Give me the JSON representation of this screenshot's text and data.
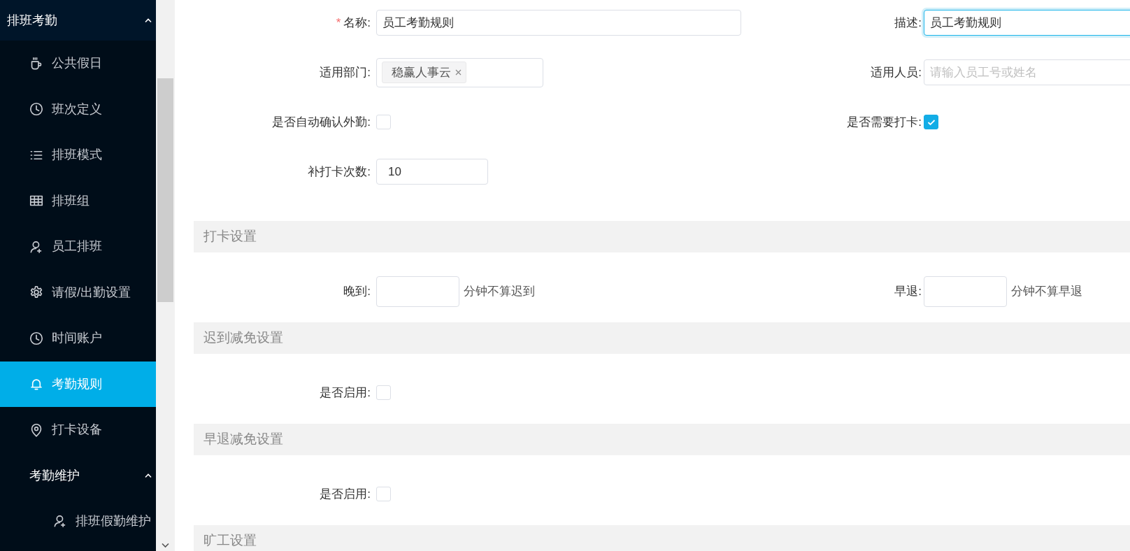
{
  "sidebar": {
    "group": {
      "label": "排班考勤",
      "expanded": true
    },
    "items": [
      {
        "label": "公共假日",
        "selected": false
      },
      {
        "label": "班次定义",
        "selected": false
      },
      {
        "label": "排班模式",
        "selected": false
      },
      {
        "label": "排班组",
        "selected": false
      },
      {
        "label": "员工排班",
        "selected": false
      },
      {
        "label": "请假/出勤设置",
        "selected": false
      },
      {
        "label": "时间账户",
        "selected": false
      },
      {
        "label": "考勤规则",
        "selected": true
      },
      {
        "label": "打卡设备",
        "selected": false
      }
    ],
    "subgroup": {
      "label": "考勤维护",
      "expanded": true,
      "items": [
        {
          "label": "排班假勤维护",
          "selected": false
        }
      ]
    }
  },
  "form": {
    "fields": [
      {
        "kind": "text",
        "label": "名称:",
        "required_mark": "*",
        "value": "员工考勤规则",
        "focused": false
      },
      {
        "kind": "text",
        "label": "描述:",
        "value": "员工考勤规则",
        "focused": true
      },
      {
        "kind": "tags",
        "label": "适用部门:",
        "tags": [
          "稳赢人事云"
        ]
      },
      {
        "kind": "text",
        "label": "适用人员:",
        "placeholder": "请输入员工号或姓名",
        "focused": false
      },
      {
        "kind": "checkbox",
        "label": "是否自动确认外勤:",
        "checked": false
      },
      {
        "kind": "checkbox",
        "label": "是否需要打卡:",
        "checked": true
      },
      {
        "kind": "text",
        "label": "补打卡次数:",
        "value": "10",
        "focused": false
      }
    ]
  },
  "sections": [
    {
      "title": "打卡设置",
      "fields": [
        {
          "kind": "minutes",
          "label": "晚到:",
          "suffix": "分钟不算迟到"
        },
        {
          "kind": "minutes",
          "label": "早退:",
          "suffix": "分钟不算早退"
        }
      ]
    },
    {
      "title": "迟到减免设置",
      "fields": [
        {
          "kind": "checkbox",
          "label": "是否启用:",
          "checked": false
        }
      ]
    },
    {
      "title": "早退减免设置",
      "fields": [
        {
          "kind": "checkbox",
          "label": "是否启用:",
          "checked": false
        }
      ]
    },
    {
      "title": "旷工设置"
    }
  ]
}
